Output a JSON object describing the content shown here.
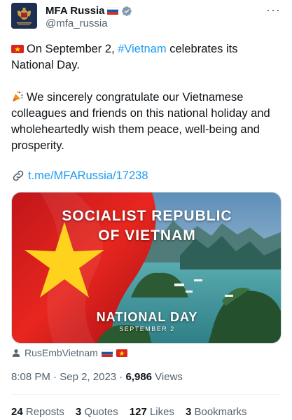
{
  "author": {
    "name": "MFA Russia",
    "handle": "@mfa_russia"
  },
  "menu": {
    "more_label": "···"
  },
  "tweet": {
    "line1_pre": "On September 2, ",
    "hashtag": "#Vietnam",
    "line1_post": " celebrates its National Day.",
    "paragraph2": "We sincerely congratulate our Vietnamese colleagues and friends on this national holiday and wholeheartedly wish them peace, well-being and prosperity.",
    "link": "t.me/MFARussia/17238"
  },
  "media": {
    "title_line1": "SOCIALIST REPUBLIC",
    "title_line2": "OF VIETNAM",
    "subtitle": "NATIONAL DAY",
    "date": "SEPTEMBER 2"
  },
  "tagged_user": "RusEmbVietnam",
  "meta": {
    "time": "8:08 PM",
    "separator": " · ",
    "date": "Sep 2, 2023",
    "views_count": "6,986",
    "views_label": " Views"
  },
  "stats": {
    "reposts_count": "24",
    "reposts_label": " Reposts",
    "quotes_count": "3",
    "quotes_label": " Quotes",
    "likes_count": "127",
    "likes_label": " Likes",
    "bookmarks_count": "3",
    "bookmarks_label": " Bookmarks"
  },
  "colors": {
    "link": "#1d9bf0",
    "secondary_text": "#536471",
    "primary_text": "#0f1419",
    "vn_red": "#da251d",
    "vn_yellow": "#ffcd00"
  }
}
